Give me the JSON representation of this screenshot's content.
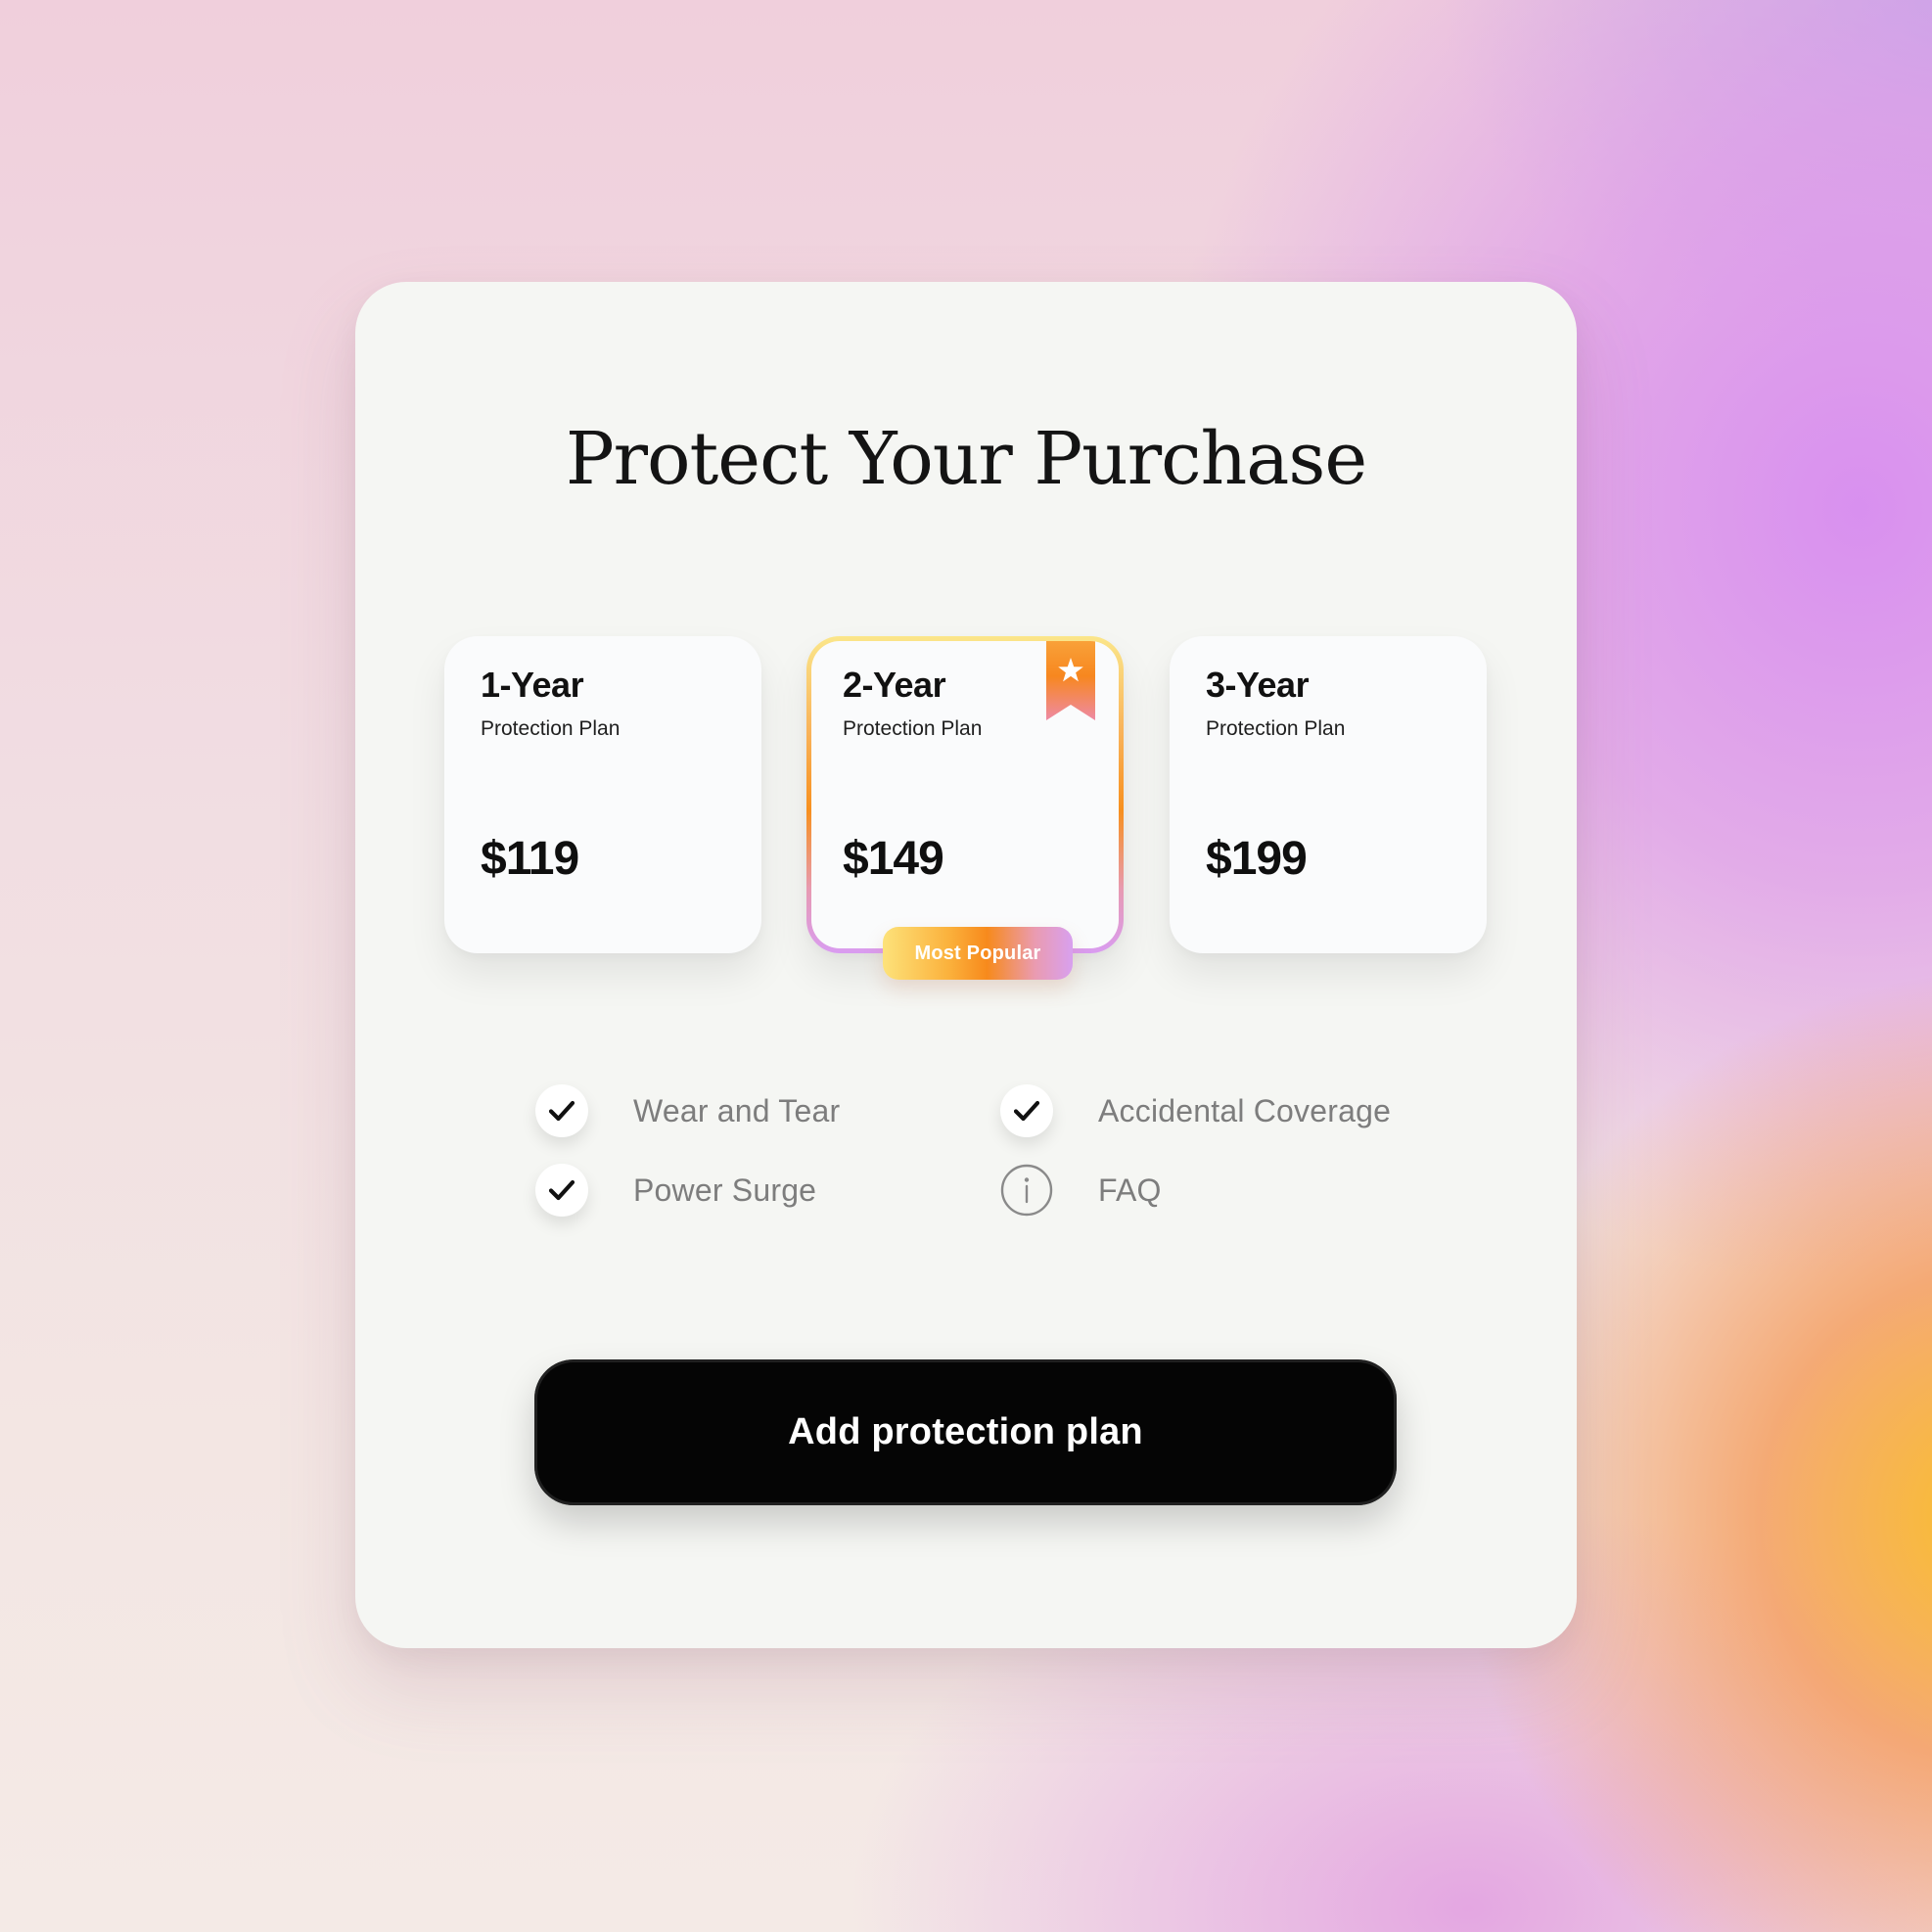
{
  "page": {
    "title": "Protect Your Purchase"
  },
  "plans": [
    {
      "years": "1-Year",
      "subtitle": "Protection Plan",
      "price": "$119",
      "selected": false
    },
    {
      "years": "2-Year",
      "subtitle": "Protection Plan",
      "price": "$149",
      "selected": true,
      "badge": "Most Popular",
      "ribbon_icon": "star-bookmark-icon"
    },
    {
      "years": "3-Year",
      "subtitle": "Protection Plan",
      "price": "$199",
      "selected": false
    }
  ],
  "features": [
    {
      "label": "Wear and Tear",
      "icon": "check-icon"
    },
    {
      "label": "Accidental Coverage",
      "icon": "check-icon"
    },
    {
      "label": "Power Surge",
      "icon": "check-icon"
    },
    {
      "label": "FAQ",
      "icon": "info-icon"
    }
  ],
  "cta": {
    "label": "Add protection plan"
  },
  "colors": {
    "panel_bg": "#f5f6f3",
    "card_bg": "#fafbfc",
    "text_primary": "#111111",
    "text_muted": "#7d7d7d",
    "cta_bg": "#050505",
    "accent_yellow": "#fde27a",
    "accent_orange": "#f78a1c",
    "accent_pink": "#ea9bb0",
    "accent_lilac": "#d8a0ef"
  }
}
